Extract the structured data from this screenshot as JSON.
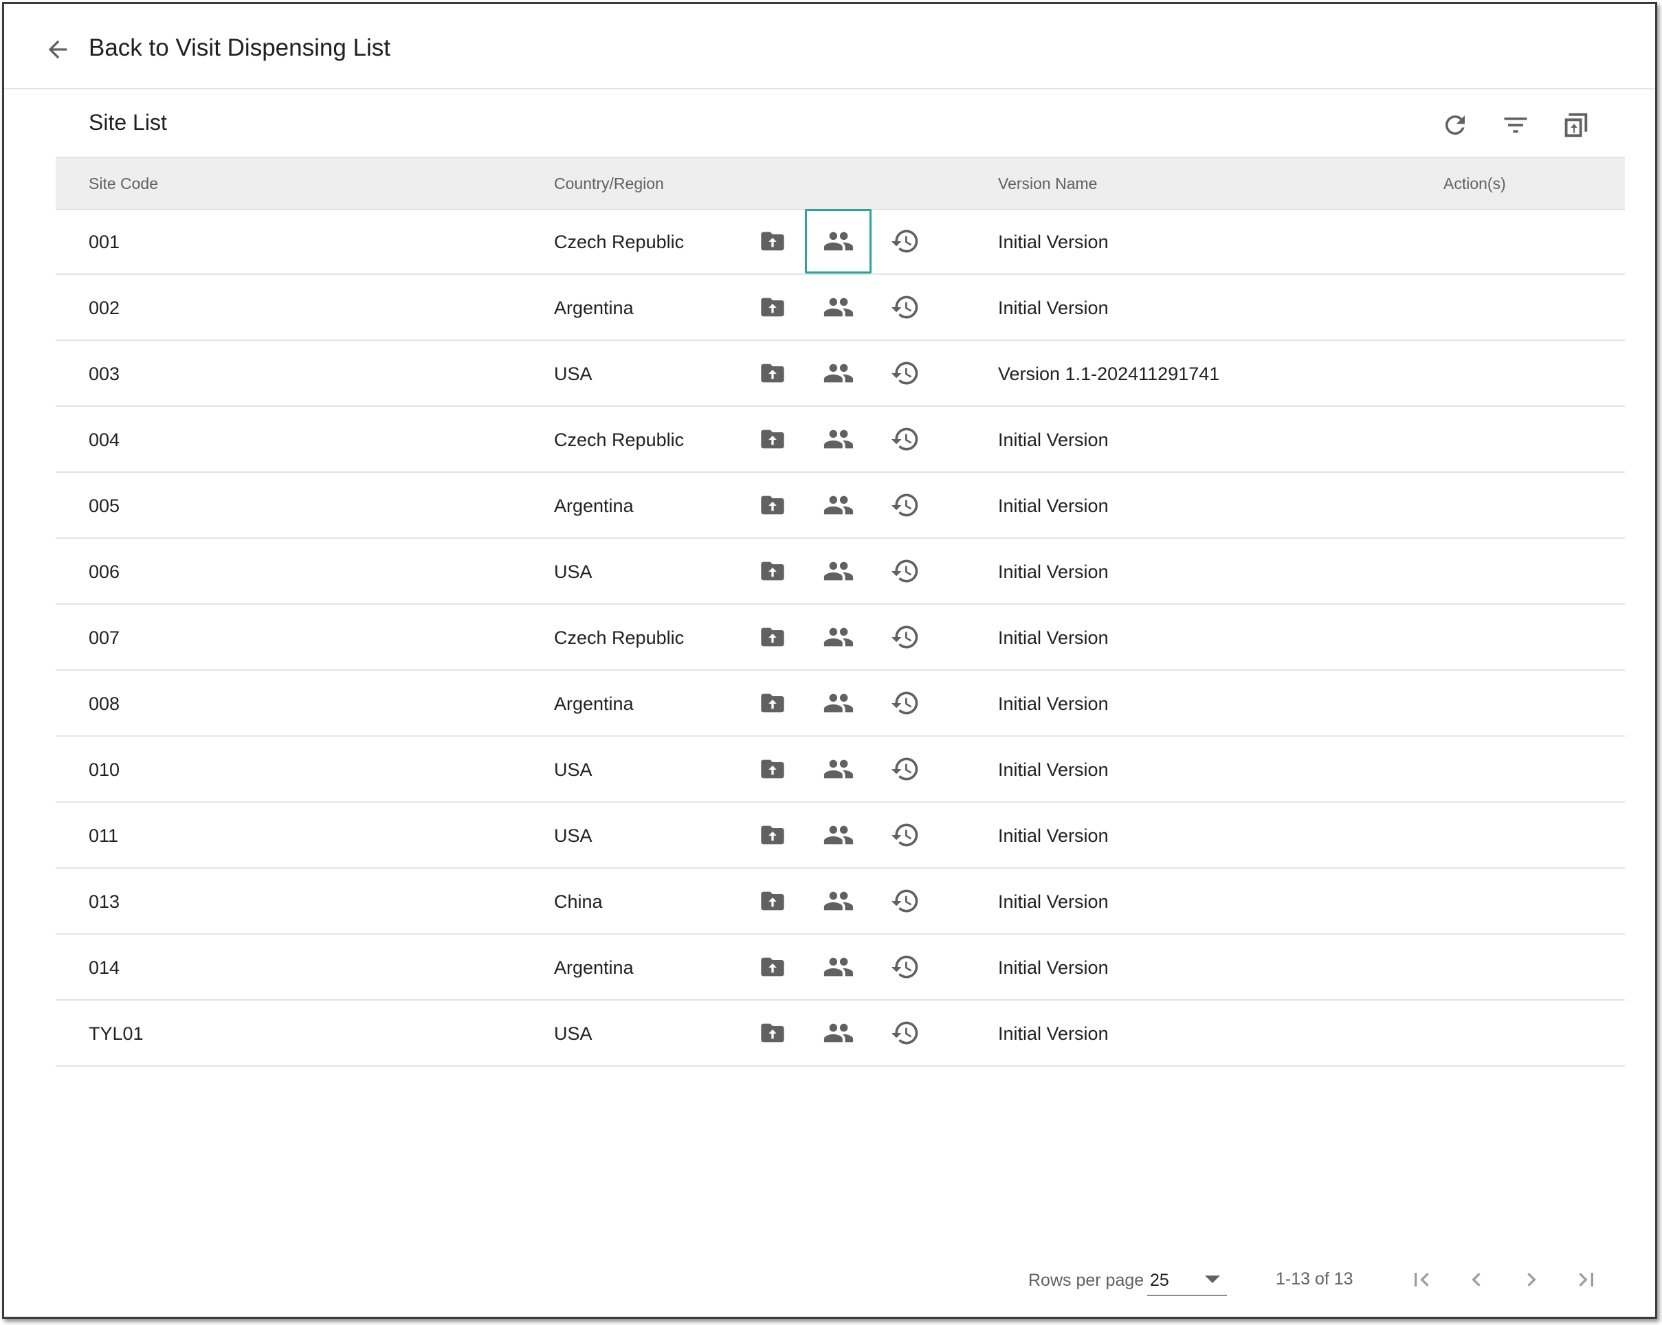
{
  "header": {
    "back_label": "Back to Visit Dispensing List",
    "back_icon": "arrow-left-icon"
  },
  "panel": {
    "title": "Site List",
    "toolbar": {
      "refresh_icon": "refresh-icon",
      "filter_icon": "filter-icon",
      "export_icon": "export-copy-icon"
    }
  },
  "table": {
    "columns": [
      "Site Code",
      "Country/Region",
      "Version Name",
      "Action(s)"
    ],
    "rows": [
      {
        "code": "001",
        "country": "Czech Republic",
        "version": "Initial Version"
      },
      {
        "code": "002",
        "country": "Argentina",
        "version": "Initial Version"
      },
      {
        "code": "003",
        "country": "USA",
        "version": "Version 1.1-202411291741"
      },
      {
        "code": "004",
        "country": "Czech Republic",
        "version": "Initial Version"
      },
      {
        "code": "005",
        "country": "Argentina",
        "version": "Initial Version"
      },
      {
        "code": "006",
        "country": "USA",
        "version": "Initial Version"
      },
      {
        "code": "007",
        "country": "Czech Republic",
        "version": "Initial Version"
      },
      {
        "code": "008",
        "country": "Argentina",
        "version": "Initial Version"
      },
      {
        "code": "010",
        "country": "USA",
        "version": "Initial Version"
      },
      {
        "code": "011",
        "country": "USA",
        "version": "Initial Version"
      },
      {
        "code": "013",
        "country": "China",
        "version": "Initial Version"
      },
      {
        "code": "014",
        "country": "Argentina",
        "version": "Initial Version"
      },
      {
        "code": "TYL01",
        "country": "USA",
        "version": "Initial Version"
      }
    ],
    "row_actions": [
      "upload-folder-icon",
      "users-icon",
      "history-icon"
    ],
    "highlighted_action": {
      "row": 0,
      "action": "users-icon",
      "color": "#26a69a"
    }
  },
  "pagination": {
    "rows_per_page_label": "Rows per page",
    "rows_per_page_value": "25",
    "range_text": "1-13 of 13"
  },
  "colors": {
    "icon": "#616161",
    "header_bg": "#eeeeee",
    "highlight": "#26a69a"
  }
}
